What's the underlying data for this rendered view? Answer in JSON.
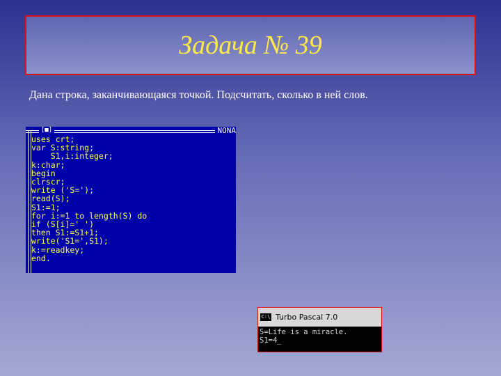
{
  "slide": {
    "title": "Задача № 39",
    "subtitle": "Дана строка, заканчивающаяся точкой. Подсчитать, сколько в ней слов."
  },
  "editor": {
    "window_name": "NONA",
    "close_glyph": "[■]",
    "lines": [
      "uses crt;",
      "var S:string;",
      "    S1,i:integer;",
      "k:char;",
      "begin",
      "clrscr;",
      "write ('S=');",
      "read(S);",
      "S1:=1;",
      "for i:=1 to length(S) do",
      "if (S[i]=' ')",
      "then S1:=S1+1;",
      "write('S1=',S1);",
      "k:=readkey;",
      "end."
    ]
  },
  "output_window": {
    "icon_label": "C:\\",
    "title": "Turbo Pascal 7.0",
    "lines": [
      "S=Life is a miracle.",
      "S1=4_"
    ]
  }
}
